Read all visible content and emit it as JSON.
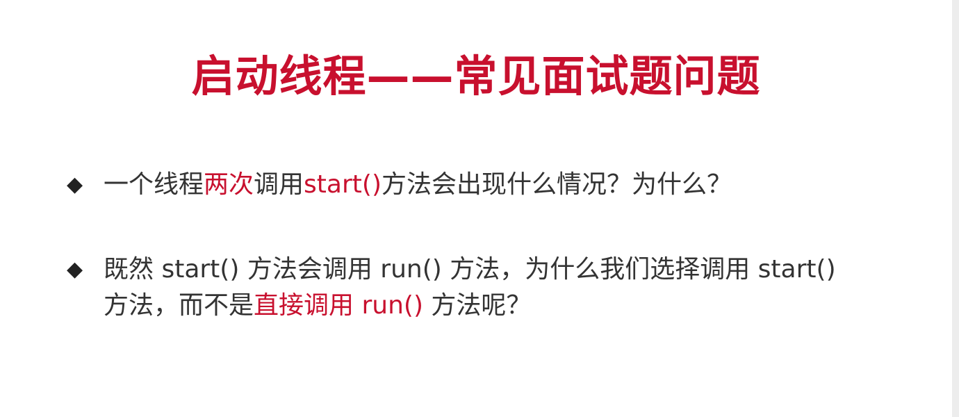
{
  "slide": {
    "title": "启动线程——常见面试题问题",
    "bullet_marker": "◆",
    "question1": {
      "part1": "一个线程",
      "highlight1": "两次",
      "part2": "调用",
      "highlight2": "start()",
      "part3": "方法会出现什么情况？为什么？"
    },
    "question2": {
      "part1": "既然 start() 方法会调用 run() 方法，为什么我们选择调用 start() 方法，而不是",
      "highlight1": "直接调用 run()",
      "part2": " 方法呢？"
    },
    "colors": {
      "accent": "#c8102e",
      "text": "#333333",
      "background": "#ffffff"
    }
  }
}
